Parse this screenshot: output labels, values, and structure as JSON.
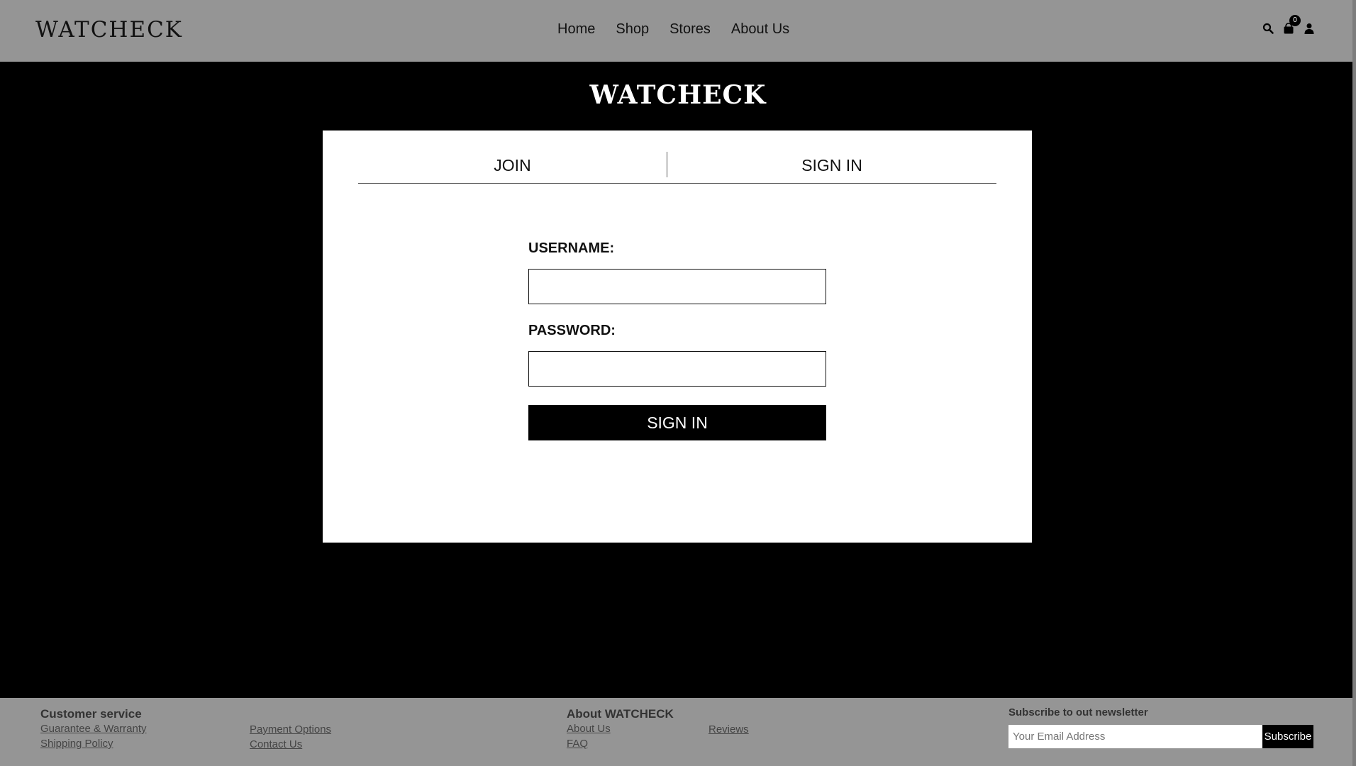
{
  "header": {
    "brand": "WATCHECK",
    "nav": [
      "Home",
      "Shop",
      "Stores",
      "About Us"
    ],
    "cart_count": "0",
    "icons": [
      "search-icon",
      "cart-icon",
      "user-icon"
    ]
  },
  "main": {
    "title": "WATCHECK",
    "tabs": [
      "JOIN",
      "SIGN IN"
    ],
    "username_label": "USERNAME:",
    "password_label": "PASSWORD:",
    "username_value": "",
    "password_value": "",
    "submit_label": "SIGN IN"
  },
  "footer": {
    "customer_service": {
      "heading": "Customer service",
      "links": [
        "Guarantee & Warranty",
        "Shipping Policy",
        "Payment Options",
        "Contact Us"
      ]
    },
    "about": {
      "heading": "About WATCHECK",
      "links": [
        "About Us",
        "FAQ",
        "Reviews"
      ]
    },
    "newsletter": {
      "heading": "Subscribe to out newsletter",
      "placeholder": "Your Email Address",
      "button": "Subscribe"
    }
  },
  "colors": {
    "header_bg": "#959595",
    "page_bg": "#000000",
    "card_bg": "#ffffff"
  }
}
